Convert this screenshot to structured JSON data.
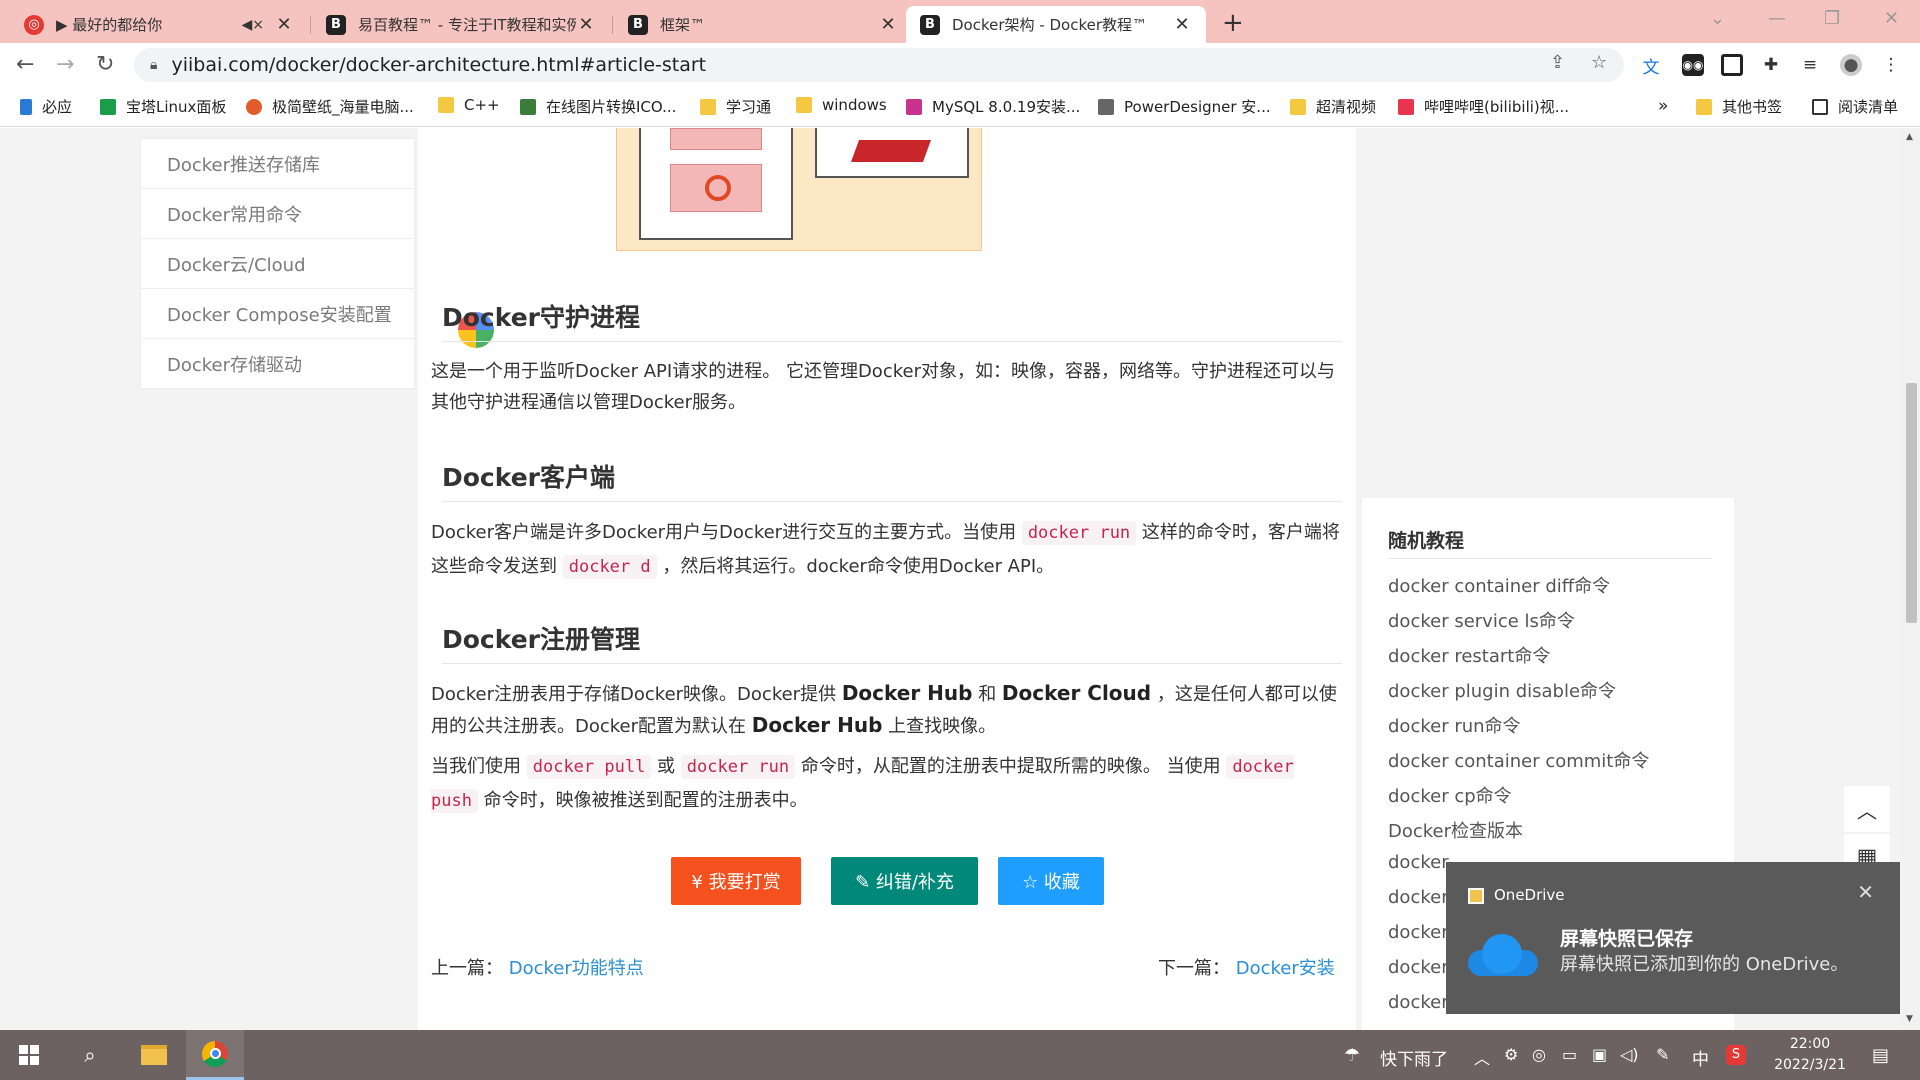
{
  "tabs": [
    {
      "title": "▶ 最好的都给你",
      "favicon": "B"
    },
    {
      "title": "易百教程™ - 专注于IT教程和实例",
      "favicon": "B"
    },
    {
      "title": "框架™",
      "favicon": "B"
    },
    {
      "title": "Docker架构 - Docker教程™",
      "favicon": "B"
    }
  ],
  "url": "yiibai.com/docker/docker-architecture.html#article-start",
  "bookmarks": [
    {
      "label": "必应",
      "color": "#2b7bd6"
    },
    {
      "label": "宝塔Linux面板",
      "color": "#1a9c4b"
    },
    {
      "label": "极简壁纸_海量电脑...",
      "color": "#e45b2a"
    },
    {
      "label": "C++",
      "color": "#f5c842"
    },
    {
      "label": "在线图片转换ICO...",
      "color": "#3a7d3a"
    },
    {
      "label": "学习通",
      "color": "#f5c842"
    },
    {
      "label": "windows",
      "color": "#f5c842"
    },
    {
      "label": "MySQL 8.0.19安装...",
      "color": "#c8338f"
    },
    {
      "label": "PowerDesigner 安...",
      "color": "#666666"
    },
    {
      "label": "超清视频",
      "color": "#f5c842"
    },
    {
      "label": "哔哩哔哩(bilibili)视...",
      "color": "#e8344e"
    }
  ],
  "bookmarks_overflow": "»",
  "other_bookmarks": "其他书签",
  "reading_list": "阅读清单",
  "sidebar": [
    "Docker推送存储库",
    "Docker常用命令",
    "Docker云/Cloud",
    "Docker Compose安装配置",
    "Docker存储驱动"
  ],
  "sections": {
    "daemon": {
      "title": "Docker守护进程",
      "text": "这是一个用于监听Docker API请求的进程。 它还管理Docker对象，如：映像，容器，网络等。守护进程还可以与其他守护进程通信以管理Docker服务。"
    },
    "client": {
      "title": "Docker客户端",
      "t1": "Docker客户端是许多Docker用户与Docker进行交互的主要方式。当使用 ",
      "c1": "docker run",
      "t2": " 这样的命令时，客户端将这些命令发送到 ",
      "c2": "docker d",
      "t3": " ，然后将其运行。docker命令使用Docker API。"
    },
    "registry": {
      "title": "Docker注册管理",
      "p1a": "Docker注册表用于存储Docker映像。Docker提供 ",
      "p1b": "Docker Hub",
      "p1c": " 和 ",
      "p1d": "Docker Cloud",
      "p1e": " ，这是任何人都可以使用的公共注册表。Docker配置为默认在 ",
      "p1f": "Docker Hub",
      "p1g": " 上查找映像。",
      "p2a": "当我们使用 ",
      "p2b": "docker pull",
      "p2c": " 或 ",
      "p2d": "docker run",
      "p2e": " 命令时，从配置的注册表中提取所需的映像。 当使用 ",
      "p2f": "docker push",
      "p2g": " 命令时，映像被推送到配置的注册表中。"
    }
  },
  "buttons": {
    "reward": "¥ 我要打赏",
    "fix": "✎ 纠错/补充",
    "fav": "☆ 收藏",
    "reward_color": "#f4511e",
    "fix_color": "#00897b",
    "fav_color": "#1e9fff"
  },
  "nav": {
    "prev_label": "上一篇：",
    "prev_link": "Docker功能特点",
    "next_label": "下一篇：",
    "next_link": "Docker安装"
  },
  "random": {
    "title": "随机教程",
    "items": [
      "docker container diff命令",
      "docker service ls命令",
      "docker restart命令",
      "docker plugin disable命令",
      "docker run命令",
      "docker container commit命令",
      "docker cp命令",
      "Docker检查版本",
      "docker",
      "docker",
      "docker",
      "docker",
      "docker"
    ]
  },
  "toast": {
    "app": "OneDrive",
    "title": "屏幕快照已保存",
    "message": "屏幕快照已添加到你的 OneDrive。"
  },
  "taskbar": {
    "weather": "快下雨了",
    "ime": "中",
    "time": "22:00",
    "date": "2022/3/21"
  }
}
